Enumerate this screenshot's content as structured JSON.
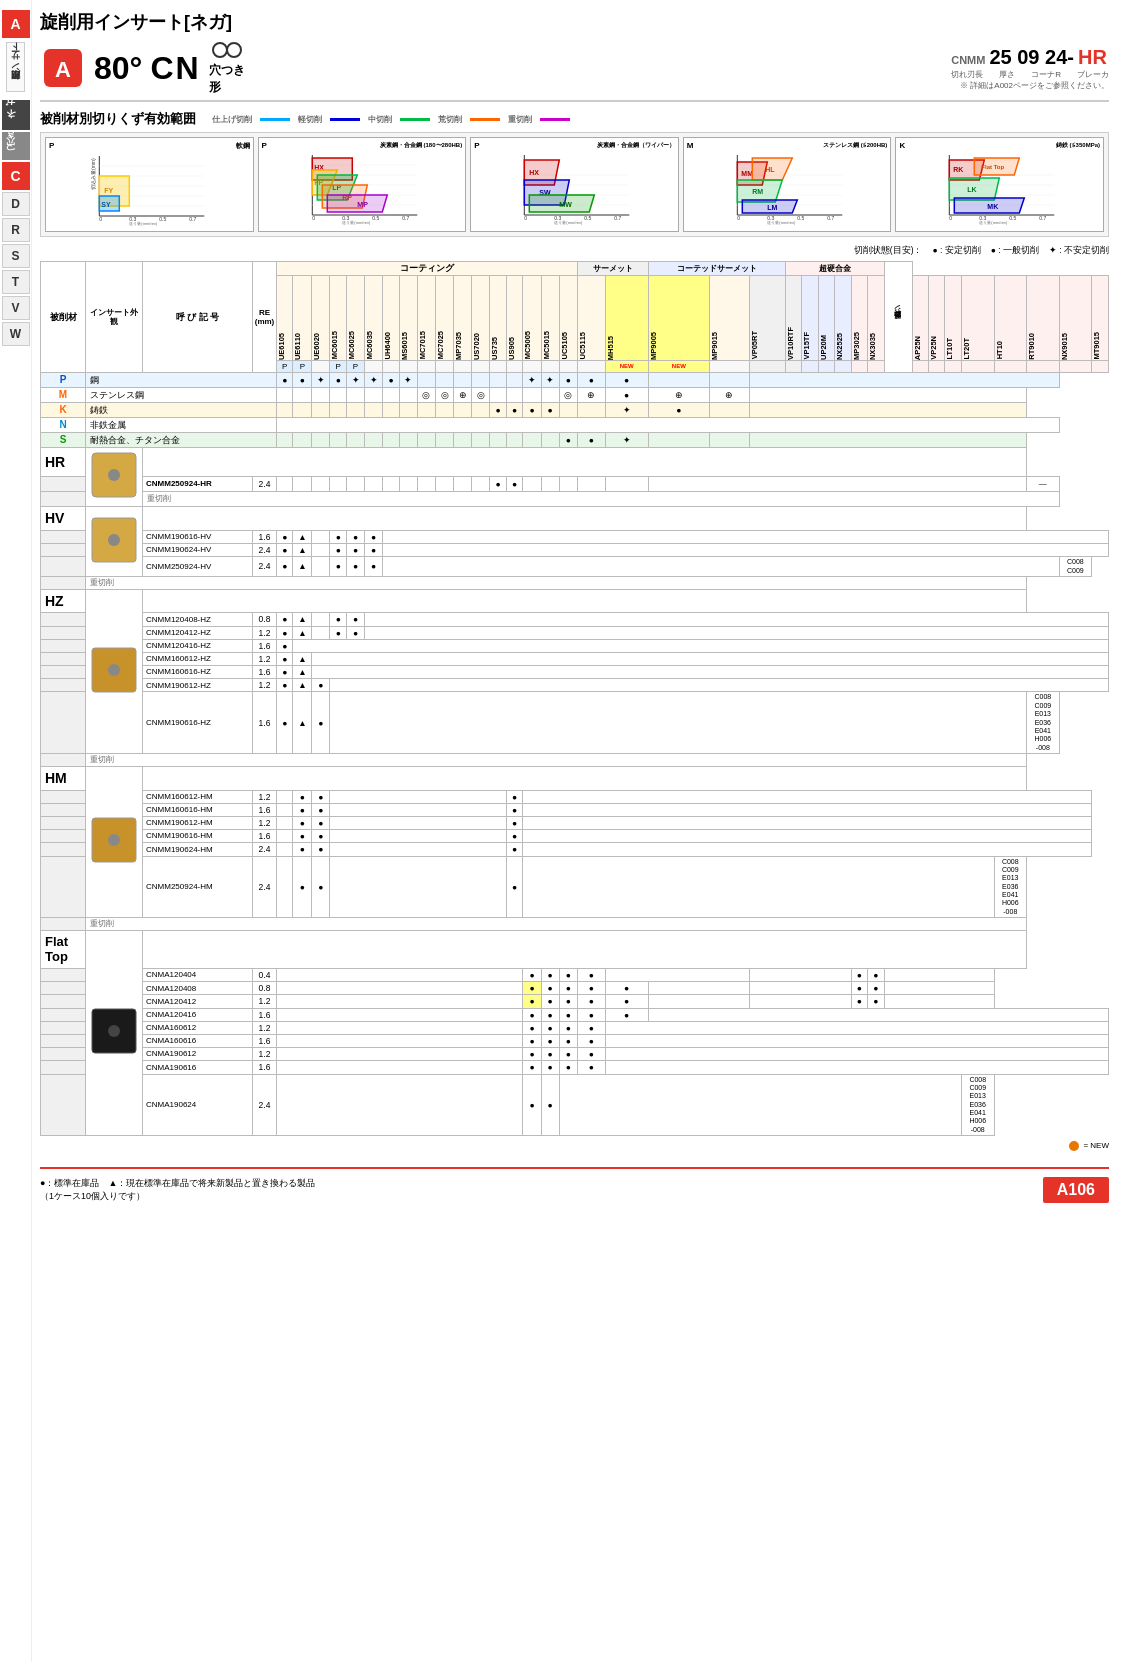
{
  "page": {
    "title": "旋削用インサート[ネガ]",
    "subtitle": "80° CN 穴つき形",
    "product_code": "CNMM 25 09 24- HR",
    "product_dims": "切れ刃長　厚さ　コーナR　ブレーカ",
    "product_note": "※ 詳細はA002ページをご参照ください。",
    "section_title": "被削材別切りくず有効範囲",
    "cutting_legend_fine": "仕上げ切削",
    "cutting_legend_light": "軽切削",
    "cutting_legend_medium": "中切削",
    "cutting_legend_heavy": "荒切削",
    "cutting_legend_vheavy": "重切削",
    "cutting_state_label": "切削状態(目安)：",
    "cutting_state_stable": "安定切削",
    "cutting_state_general": "一般切削",
    "cutting_state_unstable": "不安定切削",
    "coating_label": "コーティング",
    "cermet_label": "サーメット",
    "coated_cermet_label": "コーテッドサーメット",
    "carbide_label": "超硬合金",
    "ref_label": "参対照ページ",
    "footer_note1": "●：標準在庫品　▲：現在標準在庫品で将来新製品と置き換わる製品",
    "footer_note2": "（1ケース10個入りです）",
    "page_number": "A106",
    "new_legend": "● = NEW"
  },
  "left_nav": {
    "items": [
      {
        "label": "A",
        "type": "highlighted"
      },
      {
        "label": "旋削用インサート",
        "type": "vertical"
      },
      {
        "label": "ネガ",
        "type": "dark"
      },
      {
        "label": "穴つき",
        "type": "dark"
      },
      {
        "label": "C",
        "type": "highlighted"
      },
      {
        "label": "D",
        "type": "normal"
      },
      {
        "label": "R",
        "type": "normal"
      },
      {
        "label": "S",
        "type": "normal"
      },
      {
        "label": "T",
        "type": "normal"
      },
      {
        "label": "V",
        "type": "normal"
      },
      {
        "label": "W",
        "type": "normal"
      }
    ]
  },
  "charts": [
    {
      "p_label": "P",
      "mat_label": "軟鋼",
      "colors": {
        "FY": "#ffcc00",
        "SY": "#00aaff"
      },
      "tags": [
        "FY",
        "SY"
      ]
    },
    {
      "p_label": "P",
      "mat_label": "炭素鋼・合金鋼 (180〜280HB)",
      "colors": {
        "FP": "#ffcc00",
        "LP": "#00cc44",
        "RP": "#ff6600",
        "MP": "#cc00cc"
      },
      "tags": [
        "FP",
        "LP",
        "RP",
        "MP"
      ]
    },
    {
      "p_label": "P",
      "mat_label": "炭素鋼・合金鋼（ワイパー）",
      "colors": {
        "HX": "#cc0000",
        "SW": "#0000cc",
        "MW": "#008800"
      },
      "tags": [
        "HX",
        "SW",
        "MW"
      ]
    },
    {
      "p_label": "M",
      "mat_label": "ステンレス鋼 (≦200HB)",
      "colors": {
        "MM": "#cc0000",
        "HL": "#ff6600",
        "RM": "#00cc44",
        "LM": "#0000cc"
      },
      "tags": [
        "MM",
        "HL",
        "RM",
        "LM"
      ]
    },
    {
      "p_label": "K",
      "mat_label": "鋳鉄 (≦350MPa)",
      "colors": {
        "RK": "#cc0000",
        "Flat Top": "#ff6600",
        "LK": "#00cc44",
        "MK": "#0000cc"
      },
      "tags": [
        "RK",
        "Flat Top",
        "LK",
        "MK"
      ]
    }
  ],
  "material_rows": [
    {
      "key": "P",
      "label": "鋼",
      "symbols": [
        "●",
        "●",
        "✦",
        "●",
        "✦",
        "✦",
        "●",
        "✦"
      ]
    },
    {
      "key": "M",
      "label": "ステンレス鋼",
      "symbols": []
    },
    {
      "key": "K",
      "label": "鋳鉄",
      "symbols": []
    },
    {
      "key": "N",
      "label": "非鉄金属",
      "symbols": []
    },
    {
      "key": "S",
      "label": "耐熱合金、チタン合金",
      "symbols": []
    }
  ],
  "coating_cols": [
    "UE6105",
    "UE6110",
    "UE6020",
    "MC6015",
    "MC6025",
    "MC6035",
    "UH6400",
    "MS6015",
    "MC7015",
    "MC7025",
    "MP7035",
    "US7020",
    "US735",
    "US905",
    "MC5005",
    "MC5015",
    "UC5105",
    "UC5115",
    "MH515",
    "MP9005",
    "MP9015",
    "VP05RT",
    "VP10RTF",
    "VP15TF",
    "UP20M",
    "NX2525",
    "MP3025",
    "NX3035",
    "AP25N",
    "VP25N",
    "LT10T",
    "LT20T",
    "HT10",
    "RT9010",
    "NX9015",
    "MT9015"
  ],
  "inserts": [
    {
      "section": "HR",
      "type": "yellow",
      "label_bottom": "重切削",
      "rows": [
        {
          "name": "CNMM250924-HR",
          "re": "2.4",
          "dots": {
            "MC5105": "●●"
          },
          "ref": "—"
        }
      ]
    },
    {
      "section": "HV",
      "type": "yellow",
      "label_bottom": "重切削",
      "rows": [
        {
          "name": "CNMM190616-HV",
          "re": "1.6",
          "dots": {
            "UE6105": "●",
            "UE6110": "▲",
            "MC6015": "●●●"
          }
        },
        {
          "name": "CNMM190624-HV",
          "re": "2.4",
          "dots": {
            "UE6105": "●",
            "UE6110": "▲",
            "MC6015": "●●●"
          }
        },
        {
          "name": "CNMM250924-HV",
          "re": "2.4",
          "dots": {
            "UE6105": "●",
            "UE6110": "▲",
            "MC6015": "●●●"
          },
          "ref": "C008\nC009"
        }
      ]
    },
    {
      "section": "HZ",
      "type": "yellow",
      "label_bottom": "重切削",
      "rows": [
        {
          "name": "CNMM120408-HZ",
          "re": "0.8",
          "dots": {
            "UE6105": "●",
            "UE6110": "▲",
            "MC6015": "●●"
          }
        },
        {
          "name": "CNMM120412-HZ",
          "re": "1.2",
          "dots": {
            "UE6105": "●",
            "UE6110": "▲",
            "MC6015": "●●"
          }
        },
        {
          "name": "CNMM120416-HZ",
          "re": "1.6",
          "dots": {
            "UE6105": "●"
          }
        },
        {
          "name": "CNMM160612-HZ",
          "re": "1.2",
          "dots": {
            "UE6105": "●",
            "UE6110": "▲"
          }
        },
        {
          "name": "CNMM160616-HZ",
          "re": "1.6",
          "dots": {
            "UE6105": "●",
            "UE6110": "▲"
          }
        },
        {
          "name": "CNMM190612-HZ",
          "re": "1.2",
          "dots": {
            "UE6105": "●",
            "UE6110": "▲",
            "UE6020": "●"
          }
        },
        {
          "name": "CNMM190616-HZ",
          "re": "1.6",
          "dots": {
            "UE6105": "●",
            "UE6110": "▲",
            "UE6020": "●"
          },
          "ref": "C008\nC009\nE013\nE036\nE041\nH006\n-008"
        }
      ]
    },
    {
      "section": "HM",
      "type": "yellow",
      "label_bottom": "重切削",
      "rows": [
        {
          "name": "CNMM160612-HM",
          "re": "1.2",
          "dots": {
            "UE6110": "●●",
            "MC5005": "●"
          }
        },
        {
          "name": "CNMM160616-HM",
          "re": "1.6",
          "dots": {
            "UE6110": "●●",
            "MC5005": "●"
          }
        },
        {
          "name": "CNMM190612-HM",
          "re": "1.2",
          "dots": {
            "UE6110": "●●",
            "MC5005": "●"
          }
        },
        {
          "name": "CNMM190616-HM",
          "re": "1.6",
          "dots": {
            "UE6110": "●●",
            "MC5005": "●"
          }
        },
        {
          "name": "CNMM190624-HM",
          "re": "2.4",
          "dots": {
            "UE6110": "●●",
            "MC5005": "●"
          }
        },
        {
          "name": "CNMM250924-HM",
          "re": "2.4",
          "dots": {
            "UE6110": "●●",
            "MC5005": "●"
          },
          "ref": "C008\nC009\nE013\nE036\nE041\nH006\n-008"
        }
      ]
    },
    {
      "section": "Flat Top",
      "type": "dark",
      "label_bottom": "",
      "rows": [
        {
          "name": "CNMA120404",
          "re": "0.4",
          "dots": {
            "MH515": "●●●●",
            "HT10": "●●"
          }
        },
        {
          "name": "CNMA120408",
          "re": "0.8",
          "dots": {
            "MH515": "●●●●●",
            "HT10": "●●"
          },
          "highlight": "MH515"
        },
        {
          "name": "CNMA120412",
          "re": "1.2",
          "dots": {
            "MH515": "●●●●●",
            "HT10": "●●"
          },
          "highlight": "MH515"
        },
        {
          "name": "CNMA120416",
          "re": "1.6",
          "dots": {
            "MH515": "●●●●●"
          }
        },
        {
          "name": "CNMA160612",
          "re": "1.2",
          "dots": {
            "MH515": "●●●●"
          }
        },
        {
          "name": "CNMA160616",
          "re": "1.6",
          "dots": {
            "MH515": "●●●●"
          }
        },
        {
          "name": "CNMA190612",
          "re": "1.2",
          "dots": {
            "MH515": "●●●●"
          }
        },
        {
          "name": "CNMA190616",
          "re": "1.6",
          "dots": {
            "MH515": "●●●●"
          }
        },
        {
          "name": "CNMA190624",
          "re": "2.4",
          "dots": {
            "MH515": "●●"
          },
          "ref": "C008\nC009\nE013\nE036\nE041\nH006\n-008"
        }
      ]
    }
  ]
}
